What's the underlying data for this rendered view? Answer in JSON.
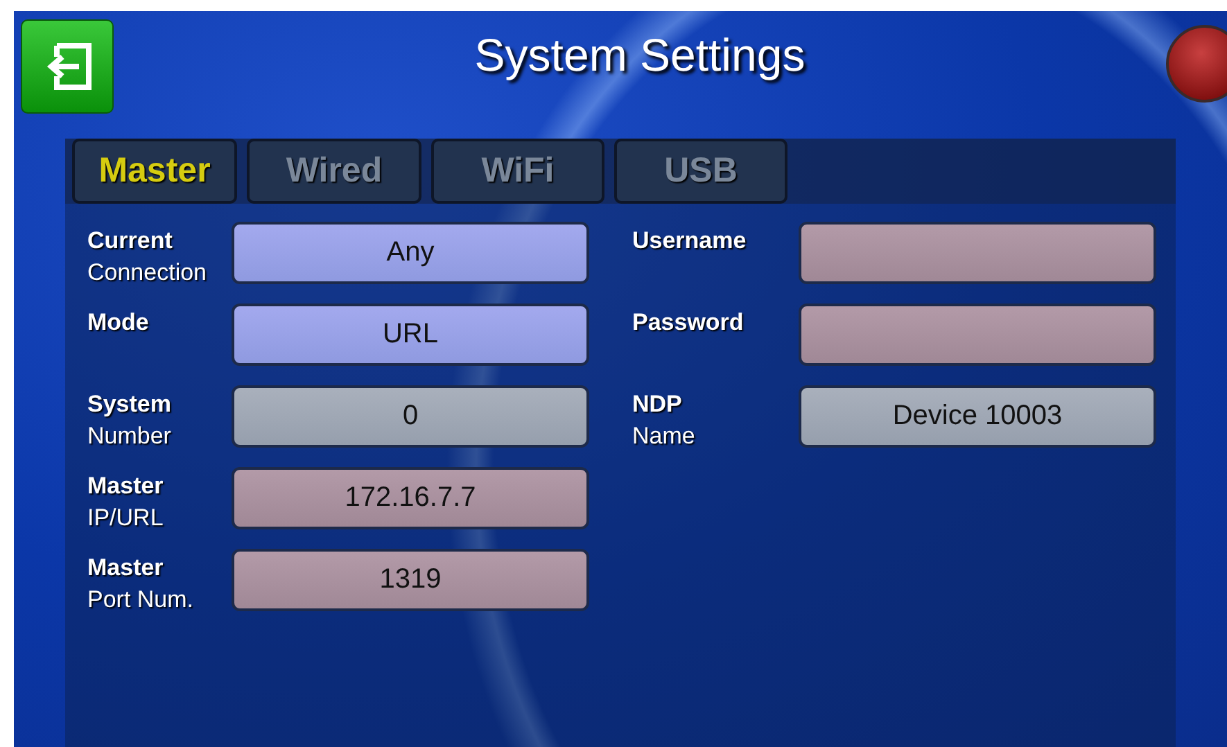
{
  "title": "System Settings",
  "tabs": [
    {
      "label": "Master",
      "selected": true
    },
    {
      "label": "Wired",
      "selected": false
    },
    {
      "label": "WiFi",
      "selected": false
    },
    {
      "label": "USB",
      "selected": false
    }
  ],
  "left_fields": [
    {
      "label": "Current",
      "sublabel": "Connection",
      "value": "Any",
      "kind": "select"
    },
    {
      "label": "Mode",
      "value": "URL",
      "kind": "select"
    },
    {
      "label": "System",
      "sublabel": "Number",
      "value": "0",
      "kind": "readonly"
    },
    {
      "label": "Master",
      "sublabel": "IP/URL",
      "value": "172.16.7.7",
      "kind": "text"
    },
    {
      "label": "Master",
      "sublabel": "Port Num.",
      "value": "1319",
      "kind": "text"
    }
  ],
  "right_fields": [
    {
      "label": "Username",
      "kind": "text"
    },
    {
      "label": "Password",
      "kind": "text"
    },
    {
      "label": "NDP",
      "sublabel": "Name",
      "value": "Device 10003",
      "kind": "readonly"
    }
  ]
}
